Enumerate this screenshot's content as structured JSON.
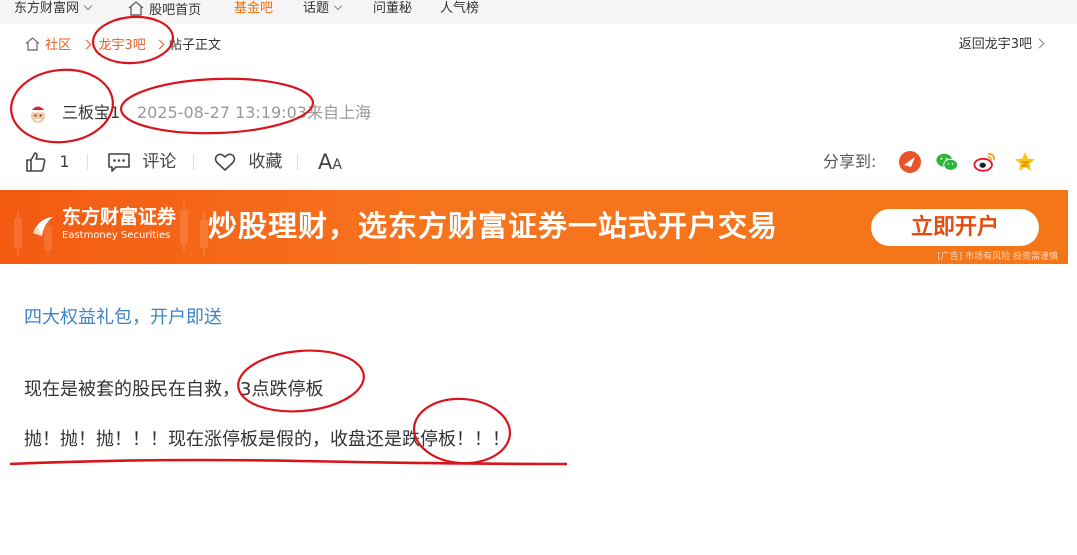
{
  "topnav": {
    "site": "东方财富网",
    "guba_home": "股吧首页",
    "fund_bar": "基金吧",
    "topic": "话题",
    "ask_secretary": "问董秘",
    "popularity": "人气榜"
  },
  "breadcrumb": {
    "community": "社区",
    "bar": "龙宇3吧",
    "current": "帖子正文",
    "back": "返回龙宇3吧"
  },
  "author": {
    "name": "三板宝1",
    "time": "2025-08-27 13:19:03",
    "location": "来自上海"
  },
  "actions": {
    "likes": "1",
    "comment": "评论",
    "favorite": "收藏",
    "font_big": "A",
    "font_small": "A",
    "share_label": "分享到:"
  },
  "banner": {
    "brand_cn": "东方财富证券",
    "brand_en": "Eastmoney Securities",
    "slogan": "炒股理财，选东方财富证券一站式开户交易",
    "cta": "立即开户",
    "note": "[广告] 市场有风险 投资需谨慎"
  },
  "post": {
    "promo_link": "四大权益礼包，开户即送",
    "line1": "现在是被套的股民在自救，3点跌停板",
    "line2": "抛！抛！抛！！！现在涨停板是假的，收盘还是跌停板！！！"
  },
  "colors": {
    "accent": "#ff6a00",
    "link": "#3c83c8",
    "annotation": "#d9141c"
  }
}
